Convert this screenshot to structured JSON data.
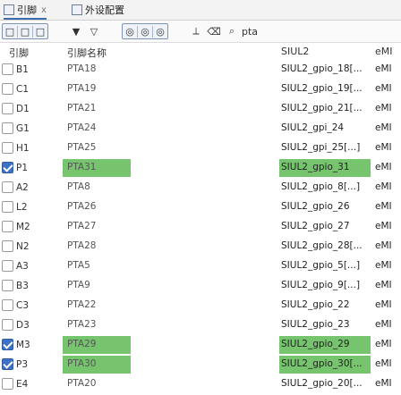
{
  "tabs": [
    {
      "label": "引脚",
      "close": "x"
    },
    {
      "label": "外设配置"
    }
  ],
  "toolbar": {
    "search_text": "pta"
  },
  "columns": [
    "引脚",
    "引脚名称",
    "",
    "",
    "SIUL2",
    "eMI"
  ],
  "rows": [
    {
      "pin": "B1",
      "name": "PTA18",
      "func": "SIUL2_gpio_18[..."
    },
    {
      "pin": "C1",
      "name": "PTA19",
      "func": "SIUL2_gpio_19[..."
    },
    {
      "pin": "D1",
      "name": "PTA21",
      "func": "SIUL2_gpio_21[..."
    },
    {
      "pin": "G1",
      "name": "PTA24",
      "func": "SIUL2_gpi_24"
    },
    {
      "pin": "H1",
      "name": "PTA25",
      "func": "SIUL2_gpi_25[...]"
    },
    {
      "pin": "P1",
      "name": "PTA31",
      "func": "SIUL2_gpio_31",
      "checked": true,
      "hl_name": true,
      "hl_func": true
    },
    {
      "pin": "A2",
      "name": "PTA8",
      "func": "SIUL2_gpio_8[...]"
    },
    {
      "pin": "L2",
      "name": "PTA26",
      "func": "SIUL2_gpio_26"
    },
    {
      "pin": "M2",
      "name": "PTA27",
      "func": "SIUL2_gpio_27"
    },
    {
      "pin": "N2",
      "name": "PTA28",
      "func": "SIUL2_gpio_28[..."
    },
    {
      "pin": "A3",
      "name": "PTA5",
      "func": "SIUL2_gpio_5[...]"
    },
    {
      "pin": "B3",
      "name": "PTA9",
      "func": "SIUL2_gpio_9[...]"
    },
    {
      "pin": "C3",
      "name": "PTA22",
      "func": "SIUL2_gpio_22"
    },
    {
      "pin": "D3",
      "name": "PTA23",
      "func": "SIUL2_gpio_23"
    },
    {
      "pin": "M3",
      "name": "PTA29",
      "func": "SIUL2_gpio_29",
      "checked": true,
      "hl_name": true,
      "hl_func": true
    },
    {
      "pin": "P3",
      "name": "PTA30",
      "func": "SIUL2_gpio_30[...",
      "checked": true,
      "hl_name": true,
      "hl_func": true
    },
    {
      "pin": "E4",
      "name": "PTA20",
      "func": "SIUL2_gpio_20[..."
    }
  ],
  "emi_label": "eMI"
}
